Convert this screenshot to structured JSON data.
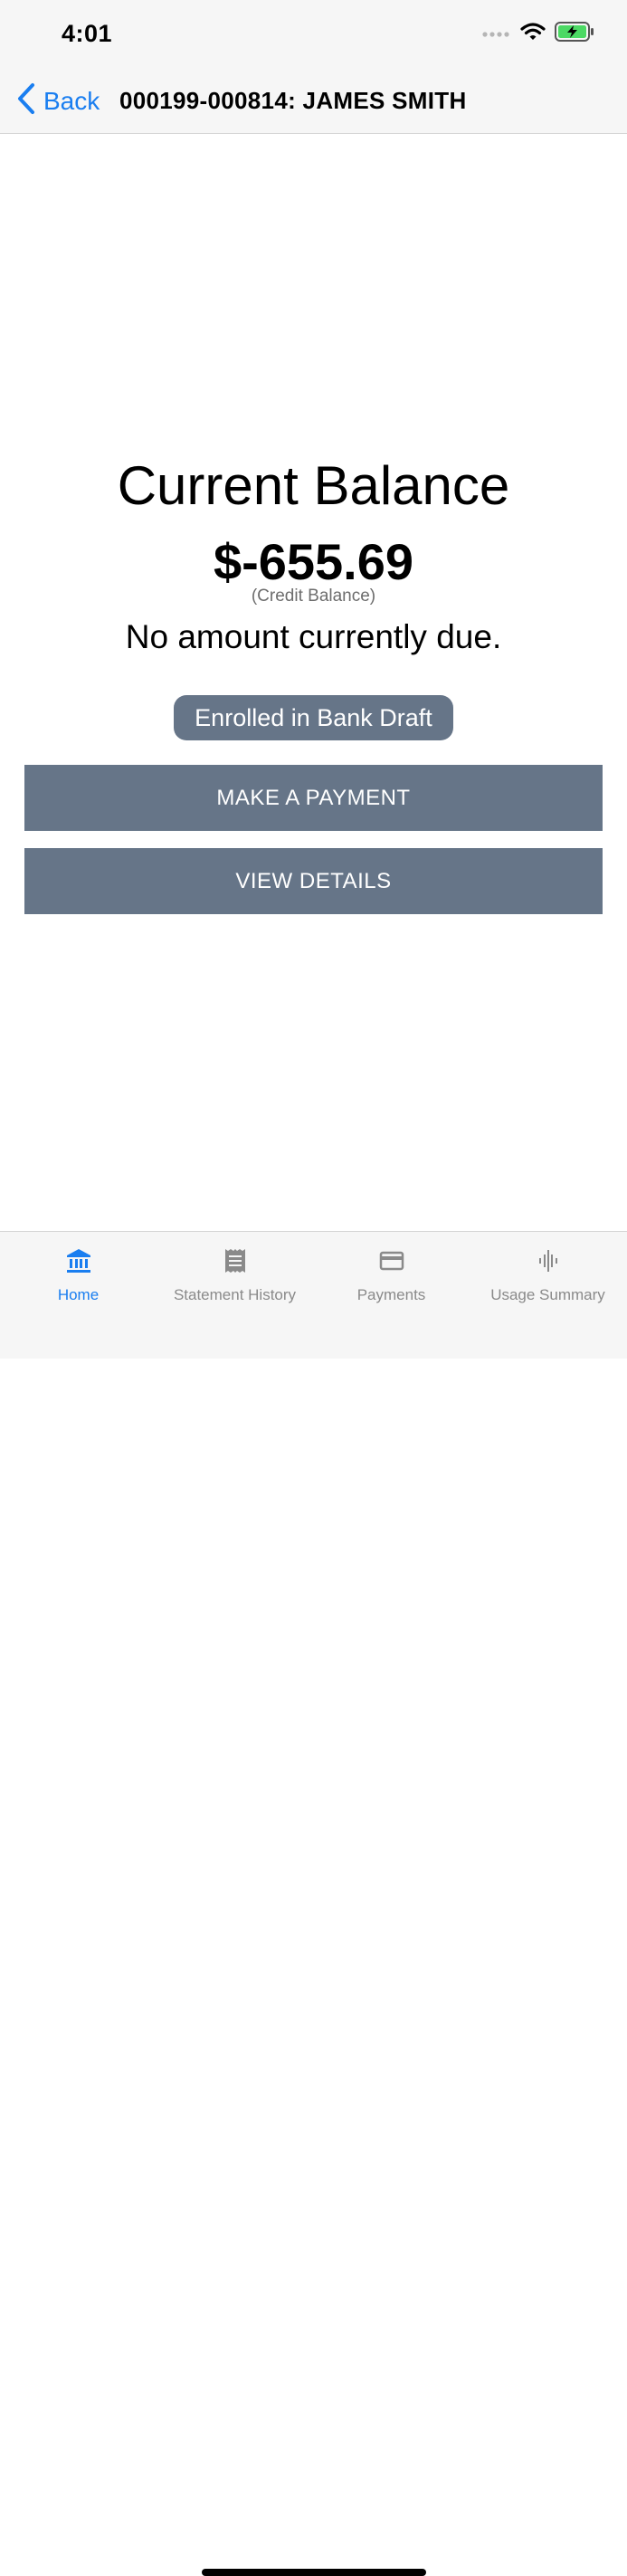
{
  "status": {
    "time": "4:01"
  },
  "nav": {
    "back_label": "Back",
    "title": "000199-000814: JAMES SMITH"
  },
  "balance": {
    "title": "Current Balance",
    "amount": "$-655.69",
    "note": "(Credit Balance)",
    "due_text": "No amount currently due.",
    "draft_badge": "Enrolled in Bank Draft"
  },
  "actions": {
    "make_payment": "MAKE A PAYMENT",
    "view_details": "VIEW DETAILS"
  },
  "tabs": [
    {
      "label": "Home",
      "icon": "bank-icon",
      "active": true
    },
    {
      "label": "Statement History",
      "icon": "receipt-icon",
      "active": false
    },
    {
      "label": "Payments",
      "icon": "credit-card-icon",
      "active": false
    },
    {
      "label": "Usage Summary",
      "icon": "waveform-icon",
      "active": false
    }
  ],
  "colors": {
    "accent": "#1a7ef0",
    "button": "#667588",
    "inactive_tab": "#8a8a8a",
    "battery": "#4cd964"
  }
}
